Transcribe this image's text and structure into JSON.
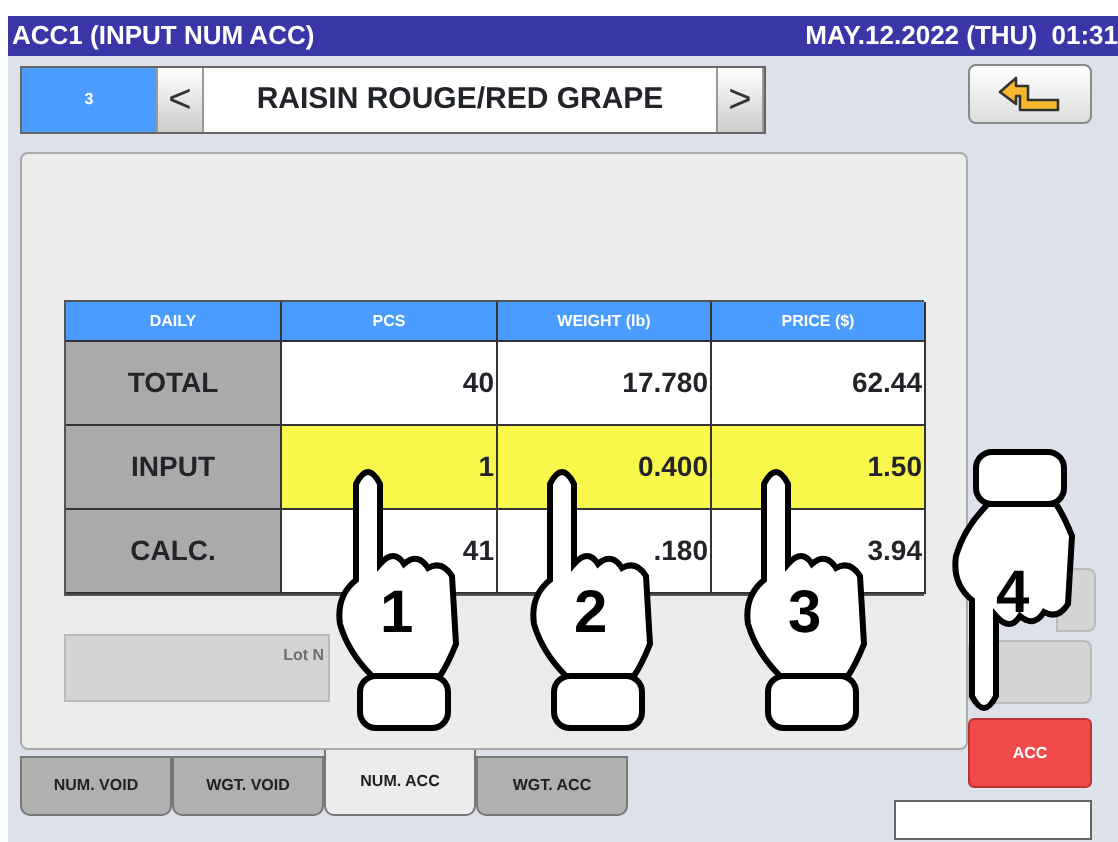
{
  "window": {
    "title": "ACC1 (INPUT NUM ACC)",
    "datetime": "MAY.12.2022 (THU)  01:31"
  },
  "product": {
    "number": "3",
    "prev": "<",
    "name": "RAISIN ROUGE/RED GRAPE",
    "next": ">"
  },
  "table": {
    "columns": [
      "DAILY",
      "PCS",
      "WEIGHT (lb)",
      "PRICE ($)"
    ],
    "rows": [
      {
        "label": "TOTAL",
        "highlighted": false,
        "cells": [
          "40",
          "17.780",
          "62.44"
        ]
      },
      {
        "label": "INPUT",
        "highlighted": true,
        "cells": [
          "1",
          "0.400",
          "1.50"
        ]
      },
      {
        "label": "CALC.",
        "highlighted": false,
        "cells": [
          "41",
          ".180",
          "3.94"
        ]
      }
    ]
  },
  "lot_button": {
    "label": "Lot N",
    "disabled": true
  },
  "tabs": [
    {
      "label": "NUM. VOID",
      "selected": false
    },
    {
      "label": "WGT. VOID",
      "selected": false
    },
    {
      "label": "NUM. ACC",
      "selected": true
    },
    {
      "label": "WGT. ACC",
      "selected": false
    }
  ],
  "side_buttons": [
    {
      "disabled": true
    },
    {
      "disabled": true
    }
  ],
  "acc_button": {
    "label": "ACC"
  },
  "annotations": [
    {
      "number": "1",
      "kind": "up"
    },
    {
      "number": "2",
      "kind": "up"
    },
    {
      "number": "3",
      "kind": "up"
    },
    {
      "number": "4",
      "kind": "down"
    }
  ]
}
